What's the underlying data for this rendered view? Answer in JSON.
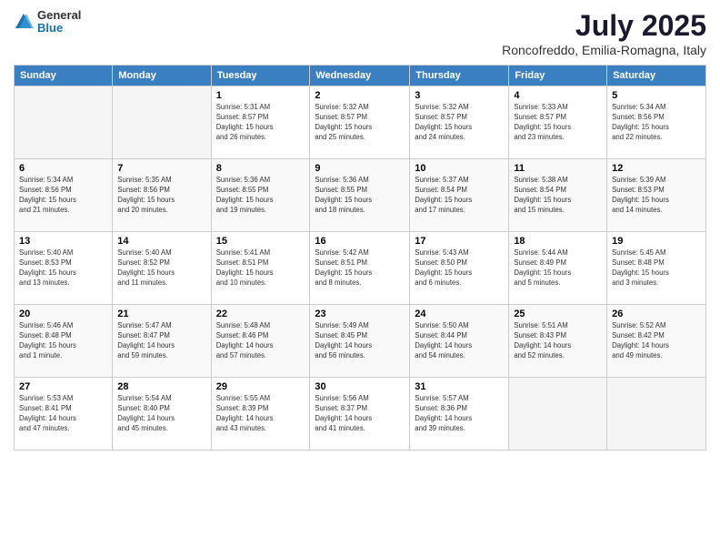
{
  "header": {
    "logo_general": "General",
    "logo_blue": "Blue",
    "month_title": "July 2025",
    "location": "Roncofreddo, Emilia-Romagna, Italy"
  },
  "weekdays": [
    "Sunday",
    "Monday",
    "Tuesday",
    "Wednesday",
    "Thursday",
    "Friday",
    "Saturday"
  ],
  "weeks": [
    [
      {
        "day": "",
        "detail": ""
      },
      {
        "day": "",
        "detail": ""
      },
      {
        "day": "1",
        "detail": "Sunrise: 5:31 AM\nSunset: 8:57 PM\nDaylight: 15 hours\nand 26 minutes."
      },
      {
        "day": "2",
        "detail": "Sunrise: 5:32 AM\nSunset: 8:57 PM\nDaylight: 15 hours\nand 25 minutes."
      },
      {
        "day": "3",
        "detail": "Sunrise: 5:32 AM\nSunset: 8:57 PM\nDaylight: 15 hours\nand 24 minutes."
      },
      {
        "day": "4",
        "detail": "Sunrise: 5:33 AM\nSunset: 8:57 PM\nDaylight: 15 hours\nand 23 minutes."
      },
      {
        "day": "5",
        "detail": "Sunrise: 5:34 AM\nSunset: 8:56 PM\nDaylight: 15 hours\nand 22 minutes."
      }
    ],
    [
      {
        "day": "6",
        "detail": "Sunrise: 5:34 AM\nSunset: 8:56 PM\nDaylight: 15 hours\nand 21 minutes."
      },
      {
        "day": "7",
        "detail": "Sunrise: 5:35 AM\nSunset: 8:56 PM\nDaylight: 15 hours\nand 20 minutes."
      },
      {
        "day": "8",
        "detail": "Sunrise: 5:36 AM\nSunset: 8:55 PM\nDaylight: 15 hours\nand 19 minutes."
      },
      {
        "day": "9",
        "detail": "Sunrise: 5:36 AM\nSunset: 8:55 PM\nDaylight: 15 hours\nand 18 minutes."
      },
      {
        "day": "10",
        "detail": "Sunrise: 5:37 AM\nSunset: 8:54 PM\nDaylight: 15 hours\nand 17 minutes."
      },
      {
        "day": "11",
        "detail": "Sunrise: 5:38 AM\nSunset: 8:54 PM\nDaylight: 15 hours\nand 15 minutes."
      },
      {
        "day": "12",
        "detail": "Sunrise: 5:39 AM\nSunset: 8:53 PM\nDaylight: 15 hours\nand 14 minutes."
      }
    ],
    [
      {
        "day": "13",
        "detail": "Sunrise: 5:40 AM\nSunset: 8:53 PM\nDaylight: 15 hours\nand 13 minutes."
      },
      {
        "day": "14",
        "detail": "Sunrise: 5:40 AM\nSunset: 8:52 PM\nDaylight: 15 hours\nand 11 minutes."
      },
      {
        "day": "15",
        "detail": "Sunrise: 5:41 AM\nSunset: 8:51 PM\nDaylight: 15 hours\nand 10 minutes."
      },
      {
        "day": "16",
        "detail": "Sunrise: 5:42 AM\nSunset: 8:51 PM\nDaylight: 15 hours\nand 8 minutes."
      },
      {
        "day": "17",
        "detail": "Sunrise: 5:43 AM\nSunset: 8:50 PM\nDaylight: 15 hours\nand 6 minutes."
      },
      {
        "day": "18",
        "detail": "Sunrise: 5:44 AM\nSunset: 8:49 PM\nDaylight: 15 hours\nand 5 minutes."
      },
      {
        "day": "19",
        "detail": "Sunrise: 5:45 AM\nSunset: 8:48 PM\nDaylight: 15 hours\nand 3 minutes."
      }
    ],
    [
      {
        "day": "20",
        "detail": "Sunrise: 5:46 AM\nSunset: 8:48 PM\nDaylight: 15 hours\nand 1 minute."
      },
      {
        "day": "21",
        "detail": "Sunrise: 5:47 AM\nSunset: 8:47 PM\nDaylight: 14 hours\nand 59 minutes."
      },
      {
        "day": "22",
        "detail": "Sunrise: 5:48 AM\nSunset: 8:46 PM\nDaylight: 14 hours\nand 57 minutes."
      },
      {
        "day": "23",
        "detail": "Sunrise: 5:49 AM\nSunset: 8:45 PM\nDaylight: 14 hours\nand 56 minutes."
      },
      {
        "day": "24",
        "detail": "Sunrise: 5:50 AM\nSunset: 8:44 PM\nDaylight: 14 hours\nand 54 minutes."
      },
      {
        "day": "25",
        "detail": "Sunrise: 5:51 AM\nSunset: 8:43 PM\nDaylight: 14 hours\nand 52 minutes."
      },
      {
        "day": "26",
        "detail": "Sunrise: 5:52 AM\nSunset: 8:42 PM\nDaylight: 14 hours\nand 49 minutes."
      }
    ],
    [
      {
        "day": "27",
        "detail": "Sunrise: 5:53 AM\nSunset: 8:41 PM\nDaylight: 14 hours\nand 47 minutes."
      },
      {
        "day": "28",
        "detail": "Sunrise: 5:54 AM\nSunset: 8:40 PM\nDaylight: 14 hours\nand 45 minutes."
      },
      {
        "day": "29",
        "detail": "Sunrise: 5:55 AM\nSunset: 8:39 PM\nDaylight: 14 hours\nand 43 minutes."
      },
      {
        "day": "30",
        "detail": "Sunrise: 5:56 AM\nSunset: 8:37 PM\nDaylight: 14 hours\nand 41 minutes."
      },
      {
        "day": "31",
        "detail": "Sunrise: 5:57 AM\nSunset: 8:36 PM\nDaylight: 14 hours\nand 39 minutes."
      },
      {
        "day": "",
        "detail": ""
      },
      {
        "day": "",
        "detail": ""
      }
    ]
  ]
}
